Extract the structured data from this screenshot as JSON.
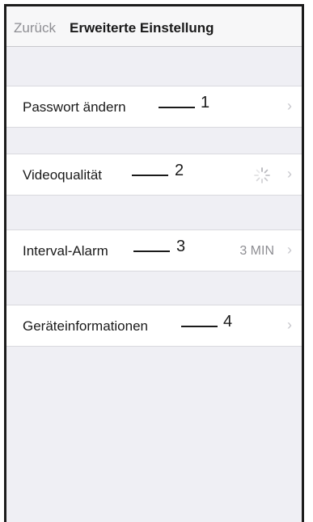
{
  "navbar": {
    "back_label": "Zurück",
    "title": "Erweiterte Einstellung"
  },
  "rows": [
    {
      "label": "Passwort ändern",
      "callout": "1",
      "value": "",
      "icon": "chevron-right-icon"
    },
    {
      "label": "Videoqualität",
      "callout": "2",
      "value": "",
      "status_icon": "loading-spinner-icon",
      "icon": "chevron-right-icon"
    },
    {
      "label": "Interval-Alarm",
      "callout": "3",
      "value": "3 MIN",
      "icon": "chevron-right-icon"
    },
    {
      "label": "Geräteinformationen",
      "callout": "4",
      "value": "",
      "icon": "chevron-right-icon"
    }
  ],
  "chevron_glyph": "›",
  "colors": {
    "background": "#efeff4",
    "cell": "#ffffff",
    "secondary_text": "#8e8e93",
    "chevron": "#c7c7cc",
    "frame_border": "#1c1c1c"
  }
}
